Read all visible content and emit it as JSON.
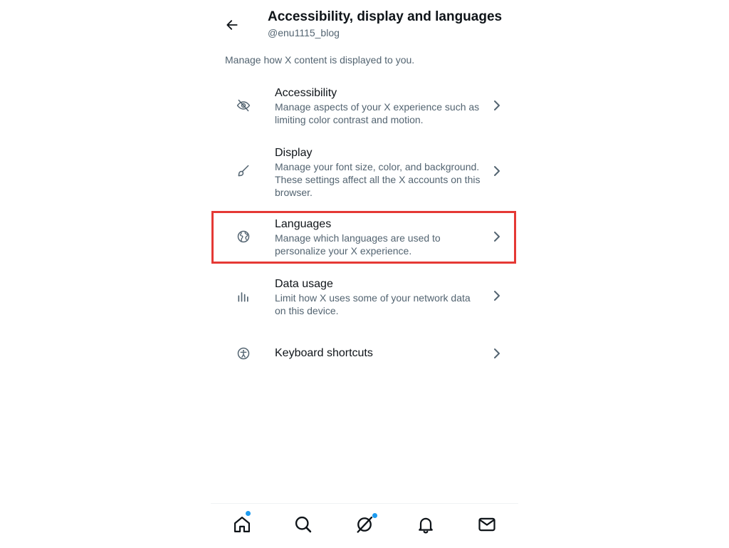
{
  "header": {
    "title": "Accessibility, display and languages",
    "handle": "@enu1115_blog"
  },
  "intro": "Manage how X content is displayed to you.",
  "items": [
    {
      "label": "Accessibility",
      "desc": "Manage aspects of your X experience such as limiting color contrast and motion.",
      "icon": "eye-off-icon"
    },
    {
      "label": "Display",
      "desc": "Manage your font size, color, and background. These settings affect all the X accounts on this browser.",
      "icon": "brush-icon"
    },
    {
      "label": "Languages",
      "desc": "Manage which languages are used to personalize your X experience.",
      "icon": "globe-icon"
    },
    {
      "label": "Data usage",
      "desc": "Limit how X uses some of your network data on this device.",
      "icon": "bar-chart-icon"
    },
    {
      "label": "Keyboard shortcuts",
      "desc": "",
      "icon": "accessibility-person-icon"
    }
  ],
  "colors": {
    "highlight": "#e53935",
    "notification_dot": "#1d9bf0",
    "secondary_text": "#536471"
  },
  "bottom_nav": [
    "home-icon",
    "search-icon",
    "grok-icon",
    "bell-icon",
    "mail-icon"
  ]
}
